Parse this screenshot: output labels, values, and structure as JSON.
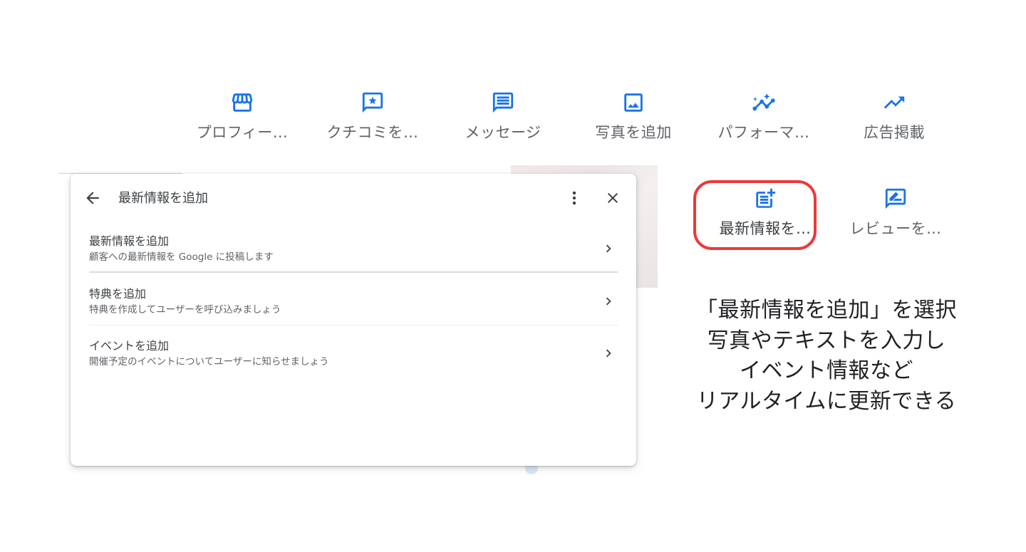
{
  "top_actions": [
    {
      "label": "プロフィー…",
      "icon": "storefront-icon"
    },
    {
      "label": "クチコミを…",
      "icon": "review-star-icon"
    },
    {
      "label": "メッセージ",
      "icon": "message-icon"
    },
    {
      "label": "写真を追加",
      "icon": "image-icon"
    },
    {
      "label": "パフォーマ…",
      "icon": "insights-icon"
    },
    {
      "label": "広告掲載",
      "icon": "trending-up-icon"
    }
  ],
  "side_actions": [
    {
      "label": "最新情報を…",
      "icon": "post-add-icon"
    },
    {
      "label": "レビューを…",
      "icon": "rate-review-icon"
    }
  ],
  "dialog": {
    "title": "最新情報を追加",
    "items": [
      {
        "title": "最新情報を追加",
        "subtitle": "顧客への最新情報を Google に投稿します"
      },
      {
        "title": "特典を追加",
        "subtitle": "特典を作成してユーザーを呼び込みましょう"
      },
      {
        "title": "イベントを追加",
        "subtitle": "開催予定のイベントについてユーザーに知らせましょう"
      }
    ]
  },
  "caption": {
    "line1": "「最新情報を追加」を選択",
    "line2": "写真やテキストを入力し",
    "line3": "イベント情報など",
    "line4": "リアルタイムに更新できる"
  },
  "colors": {
    "accent": "#1a73e8",
    "highlight": "#ea3a3a",
    "text_primary": "#3c4043",
    "text_secondary": "#5f6368"
  }
}
